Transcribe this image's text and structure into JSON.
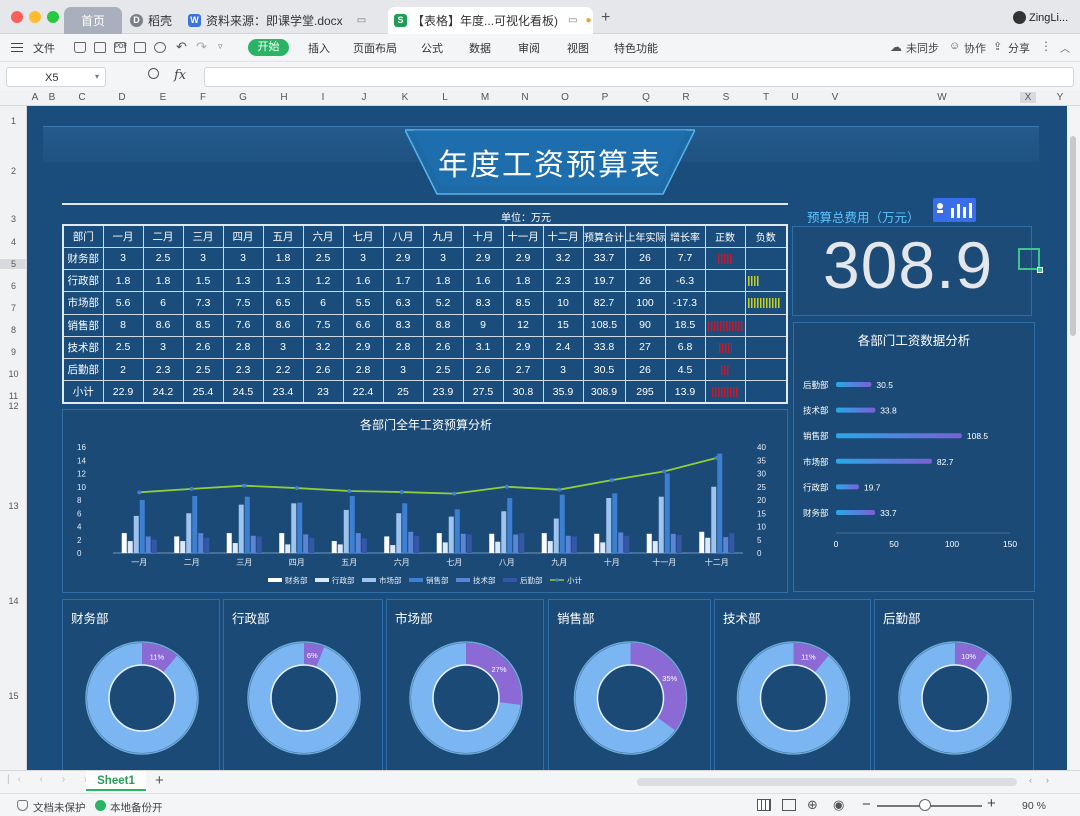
{
  "tabs": [
    {
      "label": "首页"
    },
    {
      "label": "稻壳"
    },
    {
      "label": "资料来源：即课学堂.docx"
    },
    {
      "label": "【表格】年度...可视化看板)"
    }
  ],
  "user": {
    "name": "ZingLi..."
  },
  "menu": {
    "file": "文件",
    "items": [
      "开始",
      "插入",
      "页面布局",
      "公式",
      "数据",
      "审阅",
      "视图",
      "特色功能"
    ],
    "sync": "未同步",
    "collab": "协作",
    "share": "分享"
  },
  "formula": {
    "cell_ref": "X5",
    "fx": "fx"
  },
  "columns": [
    "A",
    "B",
    "C",
    "D",
    "E",
    "F",
    "G",
    "H",
    "I",
    "J",
    "K",
    "L",
    "M",
    "N",
    "O",
    "P",
    "Q",
    "R",
    "S",
    "T",
    "U",
    "V",
    "W",
    "X",
    "Y"
  ],
  "rows": [
    "1",
    "2",
    "3",
    "4",
    "5",
    "6",
    "7",
    "8",
    "9",
    "10",
    "11",
    "12",
    "13",
    "14",
    "15"
  ],
  "dashboard": {
    "title": "年度工资预算表",
    "unit": "单位：万元",
    "total_label": "预算总费用（万元）",
    "total_value": "308.9",
    "hbar_title": "各部门工资数据分析",
    "combo_title": "各部门全年工资预算分析"
  },
  "table": {
    "headers": [
      "部门",
      "一月",
      "二月",
      "三月",
      "四月",
      "五月",
      "六月",
      "七月",
      "八月",
      "九月",
      "十月",
      "十一月",
      "十二月",
      "预算合计",
      "上年实际",
      "增长率",
      "正数",
      "负数"
    ],
    "rows": [
      [
        "财务部",
        "3",
        "2.5",
        "3",
        "3",
        "1.8",
        "2.5",
        "3",
        "2.9",
        "3",
        "2.9",
        "2.9",
        "3.2",
        "33.7",
        "26",
        "7.7"
      ],
      [
        "行政部",
        "1.8",
        "1.8",
        "1.5",
        "1.3",
        "1.3",
        "1.2",
        "1.6",
        "1.7",
        "1.8",
        "1.6",
        "1.8",
        "2.3",
        "19.7",
        "26",
        "-6.3"
      ],
      [
        "市场部",
        "5.6",
        "6",
        "7.3",
        "7.5",
        "6.5",
        "6",
        "5.5",
        "6.3",
        "5.2",
        "8.3",
        "8.5",
        "10",
        "82.7",
        "100",
        "-17.3"
      ],
      [
        "销售部",
        "8",
        "8.6",
        "8.5",
        "7.6",
        "8.6",
        "7.5",
        "6.6",
        "8.3",
        "8.8",
        "9",
        "12",
        "15",
        "108.5",
        "90",
        "18.5"
      ],
      [
        "技术部",
        "2.5",
        "3",
        "2.6",
        "2.8",
        "3",
        "3.2",
        "2.9",
        "2.8",
        "2.6",
        "3.1",
        "2.9",
        "2.4",
        "33.8",
        "27",
        "6.8"
      ],
      [
        "后勤部",
        "2",
        "2.3",
        "2.5",
        "2.3",
        "2.2",
        "2.6",
        "2.8",
        "3",
        "2.5",
        "2.6",
        "2.7",
        "3",
        "30.5",
        "26",
        "4.5"
      ],
      [
        "小计",
        "22.9",
        "24.2",
        "25.4",
        "24.5",
        "23.4",
        "23",
        "22.4",
        "25",
        "23.9",
        "27.5",
        "30.8",
        "35.9",
        "308.9",
        "295",
        "13.9"
      ]
    ],
    "growth": [
      7.7,
      -6.3,
      -17.3,
      18.5,
      6.8,
      4.5,
      13.9
    ]
  },
  "combo_chart": {
    "type": "bar",
    "categories": [
      "一月",
      "二月",
      "三月",
      "四月",
      "五月",
      "六月",
      "七月",
      "八月",
      "九月",
      "十月",
      "十一月",
      "十二月"
    ],
    "series": [
      {
        "name": "财务部",
        "values": [
          3,
          2.5,
          3,
          3,
          1.8,
          2.5,
          3,
          2.9,
          3,
          2.9,
          2.9,
          3.2
        ]
      },
      {
        "name": "行政部",
        "values": [
          1.8,
          1.8,
          1.5,
          1.3,
          1.3,
          1.2,
          1.6,
          1.7,
          1.8,
          1.6,
          1.8,
          2.3
        ]
      },
      {
        "name": "市场部",
        "values": [
          5.6,
          6,
          7.3,
          7.5,
          6.5,
          6,
          5.5,
          6.3,
          5.2,
          8.3,
          8.5,
          10
        ]
      },
      {
        "name": "销售部",
        "values": [
          8,
          8.6,
          8.5,
          7.6,
          8.6,
          7.5,
          6.6,
          8.3,
          8.8,
          9,
          12,
          15
        ]
      },
      {
        "name": "技术部",
        "values": [
          2.5,
          3,
          2.6,
          2.8,
          3,
          3.2,
          2.9,
          2.8,
          2.6,
          3.1,
          2.9,
          2.4
        ]
      },
      {
        "name": "后勤部",
        "values": [
          2,
          2.3,
          2.5,
          2.3,
          2.2,
          2.6,
          2.8,
          3,
          2.5,
          2.6,
          2.7,
          3
        ]
      }
    ],
    "line": {
      "name": "小计",
      "values": [
        22.9,
        24.2,
        25.4,
        24.5,
        23.4,
        23,
        22.4,
        25,
        23.9,
        27.5,
        30.8,
        35.9
      ]
    },
    "ylim_left": [
      0,
      16
    ],
    "yticks_left": [
      "0",
      "2",
      "4",
      "6",
      "8",
      "10",
      "12",
      "14",
      "16"
    ],
    "ylim_right": [
      0,
      40
    ],
    "yticks_right": [
      "0",
      "5",
      "10",
      "15",
      "20",
      "25",
      "30",
      "35",
      "40"
    ],
    "colors": [
      "#ffffff",
      "#dbe9fa",
      "#9ec3ee",
      "#3d7fd0",
      "#5a84d8",
      "#3656a8"
    ],
    "line_color": "#8fce3a"
  },
  "hbar_chart": {
    "type": "bar",
    "categories": [
      "后勤部",
      "技术部",
      "销售部",
      "市场部",
      "行政部",
      "财务部"
    ],
    "values": [
      30.5,
      33.8,
      108.5,
      82.7,
      19.7,
      33.7
    ],
    "xlim": [
      0,
      150
    ],
    "xticks": [
      "0",
      "50",
      "100",
      "150"
    ]
  },
  "donuts": [
    {
      "name": "财务部",
      "pct": 11,
      "label": "11%"
    },
    {
      "name": "行政部",
      "pct": 6,
      "label": "6%"
    },
    {
      "name": "市场部",
      "pct": 27,
      "label": "27%"
    },
    {
      "name": "销售部",
      "pct": 35,
      "label": "35%"
    },
    {
      "name": "技术部",
      "pct": 11,
      "label": "11%"
    },
    {
      "name": "后勤部",
      "pct": 10,
      "label": "10%"
    }
  ],
  "sheet_tabs": [
    "Sheet1"
  ],
  "status": {
    "protect": "文档未保护",
    "backup": "本地备份开",
    "zoom": "90 %"
  }
}
